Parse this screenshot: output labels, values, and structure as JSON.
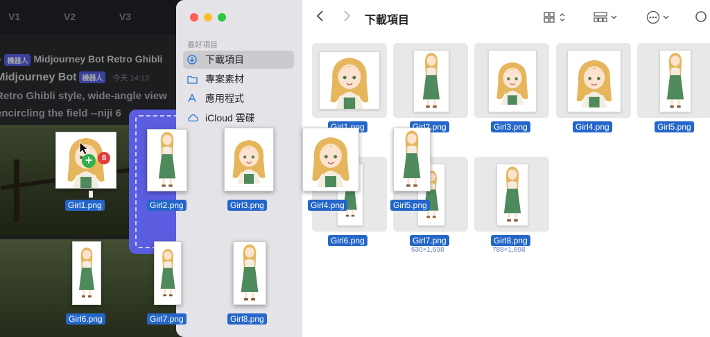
{
  "background": {
    "tabs": [
      "V1",
      "V2",
      "V3"
    ],
    "line1_prefix": "",
    "line1_badge": "機器人",
    "line1_text": "Midjourney Bot Retro Ghibli",
    "line2_name": "Midjourney Bot",
    "line2_badge": "機器人",
    "line2_time": "今天 14:13",
    "line3": "Retro Ghibli style, wide-angle view",
    "line4": "encircling the field --niji 6"
  },
  "finder": {
    "sidebar_header": "喜好項目",
    "sidebar_items": [
      {
        "label": "下載項目",
        "icon": "download-icon"
      },
      {
        "label": "專案素材",
        "icon": "folder-icon"
      },
      {
        "label": "應用程式",
        "icon": "applications-icon"
      },
      {
        "label": "iCloud 雲碟",
        "icon": "cloud-icon"
      }
    ],
    "title": "下載項目",
    "grid_items": [
      {
        "name": "Girl1.png"
      },
      {
        "name": "Girl2.png"
      },
      {
        "name": "Girl3.png"
      },
      {
        "name": "Girl4.png"
      },
      {
        "name": "Girl5.png"
      },
      {
        "name": "Girl6.png"
      },
      {
        "name": "Girl7.png",
        "dims": "630×1,698"
      },
      {
        "name": "Girl8.png",
        "dims": "788×1,698"
      }
    ]
  },
  "drag": {
    "items": [
      "Girl1.png",
      "Girl2.png",
      "Girl3.png",
      "Girl4.png",
      "Girl5.png",
      "Girl6.png",
      "Girl7.png",
      "Girl8.png"
    ],
    "count": "8",
    "plus": "+"
  },
  "colors": {
    "selection": "#2466c9",
    "dropzone": "#5a5de0",
    "dress": "#4f8a5c",
    "hair": "#e6b65c"
  }
}
